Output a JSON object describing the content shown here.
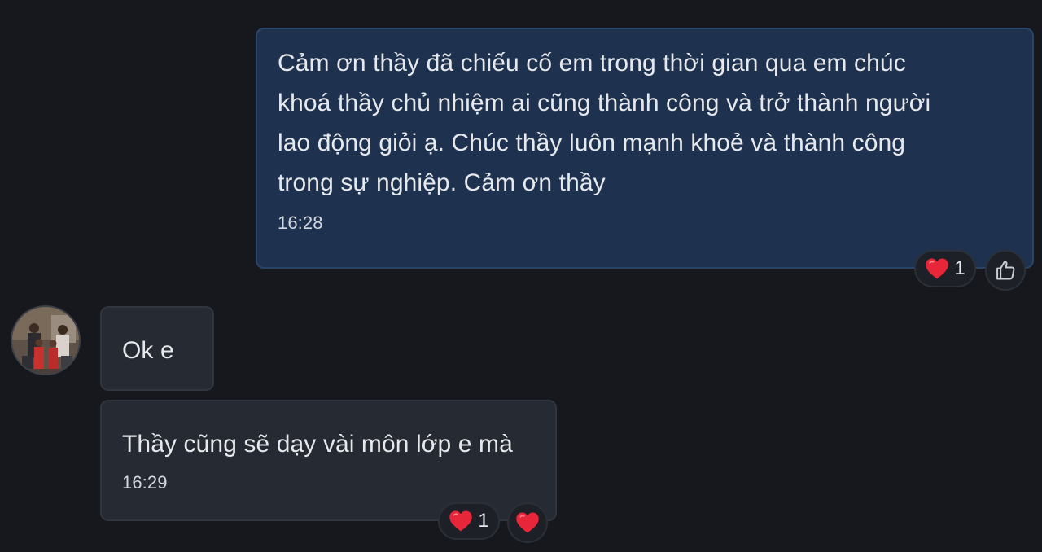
{
  "conversation": {
    "outgoing": {
      "text": "Cảm ơn thầy đã chiếu cố em trong thời gian qua em chúc\nkhoá thầy chủ nhiệm ai cũng thành công và trở thành người\nlao động giỏi ạ. Chúc thầy luôn mạnh khoẻ và thành công\ntrong sự nghiệp. Cảm ơn thầy",
      "time": "16:28",
      "reaction_count": "1"
    },
    "incoming": [
      {
        "text": "Ok e"
      },
      {
        "text": "Thầy cũng sẽ dạy vài môn lớp e mà",
        "time": "16:29",
        "reaction_count": "1"
      }
    ]
  },
  "colors": {
    "background": "#16181d",
    "outgoing_bubble": "#1e3250",
    "incoming_bubble": "#252a33",
    "heart": "#e8263a"
  },
  "icons": [
    "heart-icon",
    "thumbs-up-icon"
  ]
}
